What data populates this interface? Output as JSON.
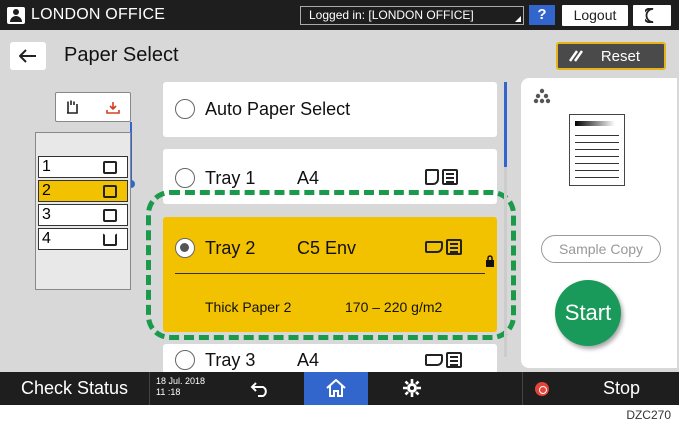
{
  "topbar": {
    "office_label": "LONDON OFFICE",
    "logged_in": "Logged in: [LONDON OFFICE]",
    "help_label": "?",
    "logout_label": "Logout"
  },
  "header": {
    "title": "Paper Select",
    "reset_label": "Reset"
  },
  "diagram": {
    "trays": [
      "1",
      "2",
      "3",
      "4"
    ],
    "selected_tray": "2"
  },
  "trays": [
    {
      "label": "Auto Paper Select",
      "selected": false
    },
    {
      "label": "Tray 1",
      "size": "A4",
      "selected": false
    },
    {
      "label": "Tray 2",
      "size": "C5 Env",
      "selected": true,
      "paper_type": "Thick Paper 2",
      "weight": "170 – 220 g/m2",
      "locked": true
    },
    {
      "label": "Tray 3",
      "size": "A4",
      "selected": false
    }
  ],
  "panel": {
    "sample_copy_label": "Sample Copy",
    "start_label": "Start"
  },
  "bottombar": {
    "check_status_label": "Check Status",
    "date": "18 Jul. 2018",
    "time": "11 :18",
    "stop_label": "Stop"
  },
  "caption": "DZC270",
  "colors": {
    "accent_yellow": "#f2c200",
    "start_green": "#1a9a5a",
    "highlight_blue": "#3366cc",
    "dash_green": "#1a9a4a"
  }
}
